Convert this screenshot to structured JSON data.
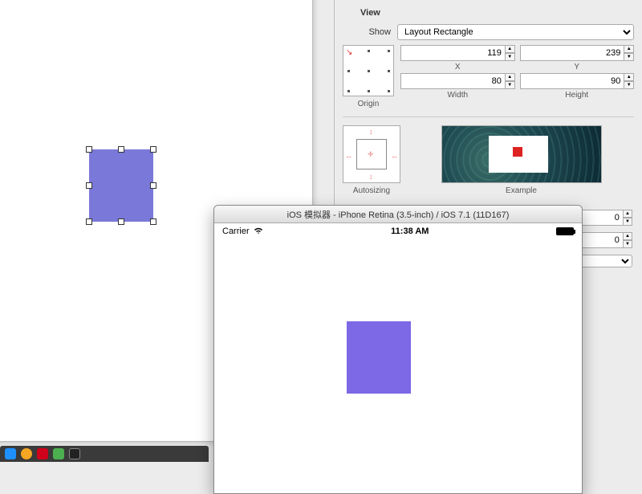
{
  "inspector": {
    "section": "View",
    "show_label": "Show",
    "show_value": "Layout Rectangle",
    "x_value": "119",
    "y_value": "239",
    "width_value": "80",
    "height_value": "90",
    "x_label": "X",
    "y_label": "Y",
    "width_label": "Width",
    "height_label": "Height",
    "origin_label": "Origin",
    "autosizing_label": "Autosizing",
    "example_label": "Example",
    "extra1_value": "0",
    "extra2_value": "0"
  },
  "simulator": {
    "title": "iOS 模拟器 - iPhone Retina (3.5-inch) / iOS 7.1 (11D167)",
    "carrier": "Carrier",
    "time": "11:38 AM"
  }
}
